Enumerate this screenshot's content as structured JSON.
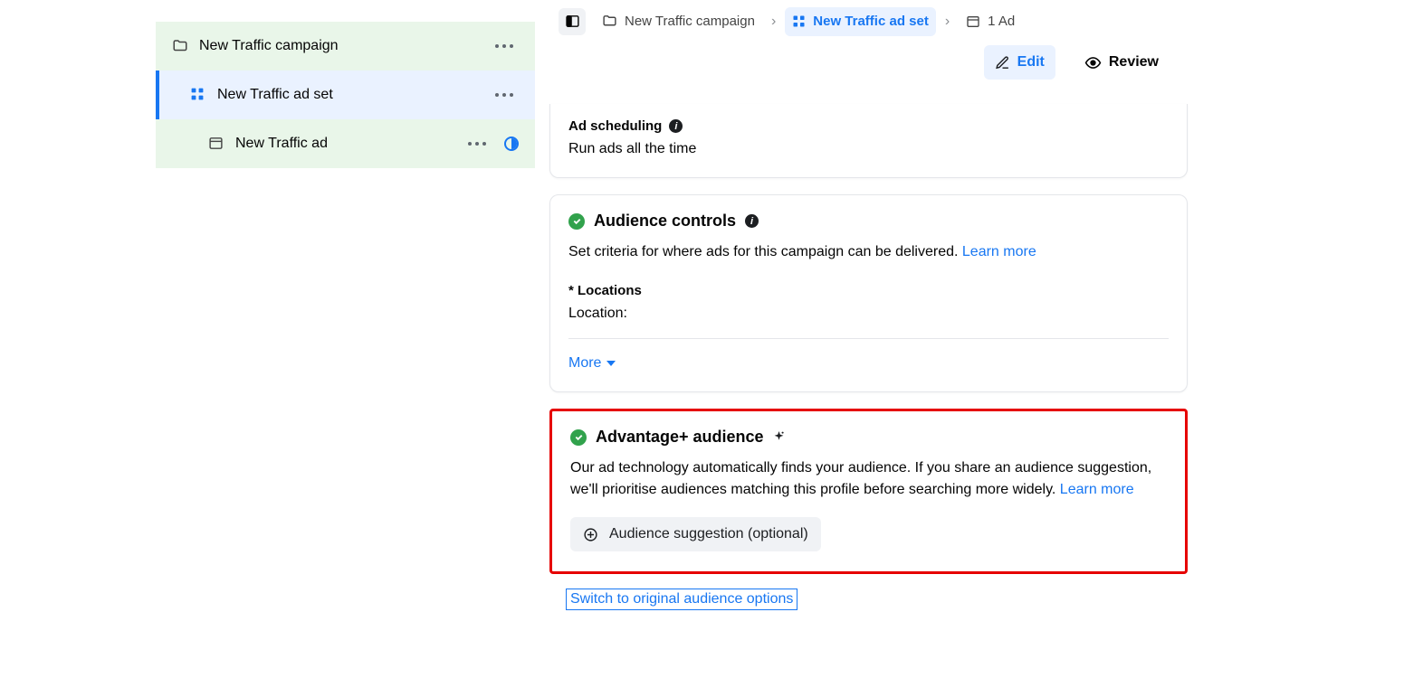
{
  "tree": {
    "campaign": "New Traffic campaign",
    "adset": "New Traffic ad set",
    "ad": "New Traffic ad"
  },
  "breadcrumb": {
    "campaign": "New Traffic campaign",
    "adset": "New Traffic ad set",
    "ad": "1 Ad"
  },
  "actions": {
    "edit": "Edit",
    "review": "Review"
  },
  "scheduling": {
    "heading": "Ad scheduling",
    "value": "Run ads all the time"
  },
  "audience_controls": {
    "heading": "Audience controls",
    "description": "Set criteria for where ads for this campaign can be delivered. ",
    "learn_more": "Learn more",
    "locations_label": "* Locations",
    "location_value": "Location:",
    "more": "More"
  },
  "advantage": {
    "heading": "Advantage+ audience",
    "description": "Our ad technology automatically finds your audience. If you share an audience suggestion, we'll prioritise audiences matching this profile before searching more widely. ",
    "learn_more": "Learn more",
    "suggestion_btn": "Audience suggestion (optional)"
  },
  "switch_link": "Switch to original audience options"
}
